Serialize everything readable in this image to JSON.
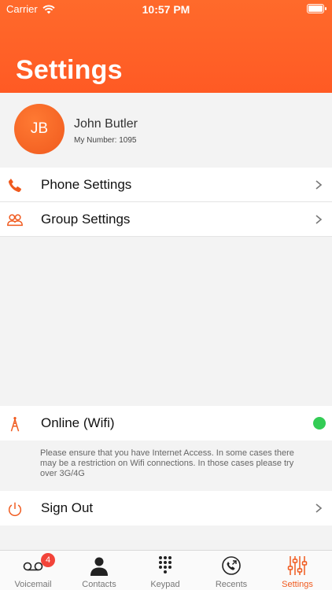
{
  "status_bar": {
    "carrier": "Carrier",
    "time": "10:57 PM"
  },
  "header": {
    "title": "Settings"
  },
  "profile": {
    "initials": "JB",
    "name": "John Butler",
    "number": "My Number: 1095"
  },
  "menu": [
    {
      "label": "Phone Settings",
      "icon": "phone-icon"
    },
    {
      "label": "Group Settings",
      "icon": "group-icon"
    }
  ],
  "connection": {
    "label": "Online (Wifi)",
    "icon": "antenna-icon",
    "status_color": "#33cc55",
    "note": "Please ensure that you have Internet Access. In some cases there may be a restriction on Wifi connections. In those cases please try over 3G/4G"
  },
  "sign_out": {
    "label": "Sign Out",
    "icon": "power-icon"
  },
  "tabs": [
    {
      "label": "Voicemail",
      "icon": "voicemail-icon",
      "badge": "4"
    },
    {
      "label": "Contacts",
      "icon": "contacts-icon"
    },
    {
      "label": "Keypad",
      "icon": "keypad-icon"
    },
    {
      "label": "Recents",
      "icon": "recents-icon"
    },
    {
      "label": "Settings",
      "icon": "settings-sliders-icon",
      "active": true
    }
  ],
  "colors": {
    "accent": "#f05a1e",
    "header": "#ff5a24",
    "online": "#33cc55",
    "badge": "#f2443a"
  }
}
